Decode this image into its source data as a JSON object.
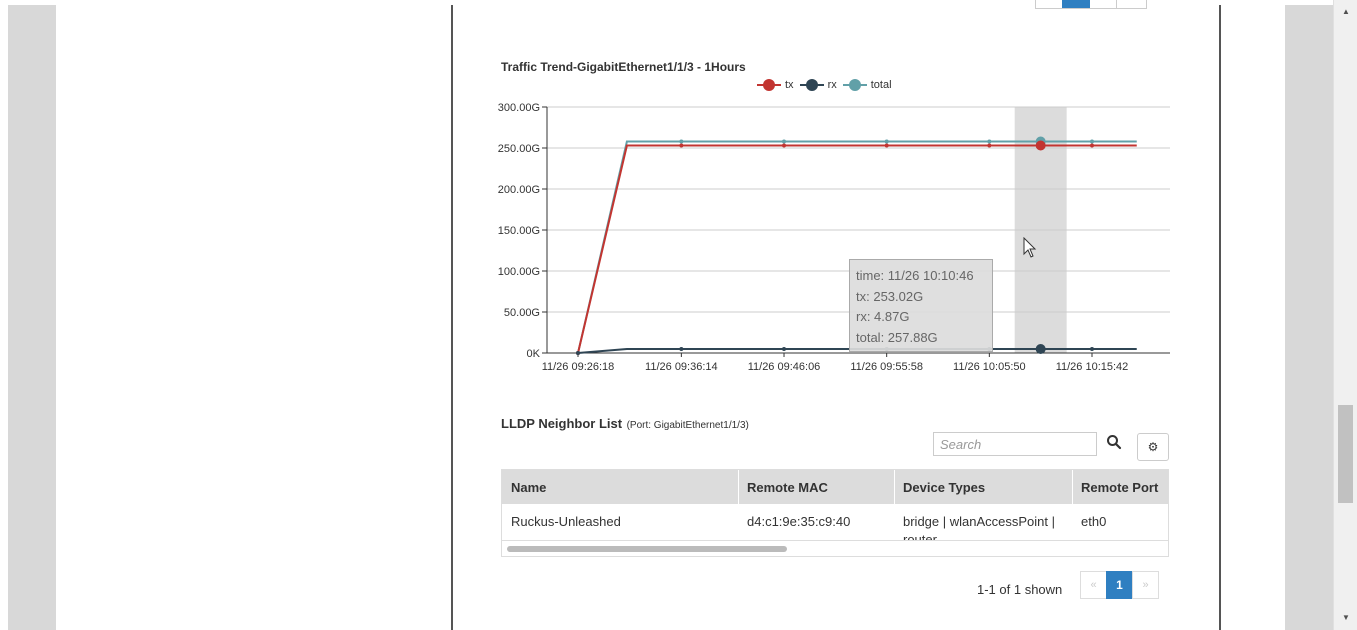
{
  "chart_data": {
    "type": "line",
    "title": "Traffic Trend-GigabitEthernet1/1/3 - 1Hours",
    "x_tick_labels": [
      "11/26 09:26:18",
      "11/26 09:36:14",
      "11/26 09:46:06",
      "11/26 09:55:58",
      "11/26 10:05:50",
      "11/26 10:15:42"
    ],
    "y_tick_labels": [
      "0K",
      "50.00G",
      "100.00G",
      "150.00G",
      "200.00G",
      "250.00G",
      "300.00G"
    ],
    "ylim": [
      0,
      300
    ],
    "y_unit": "G",
    "grid": true,
    "legend_position": "top",
    "x_points": [
      "11/26 09:26:18",
      "11/26 09:31:00",
      "11/26 09:36:14",
      "11/26 09:46:06",
      "11/26 09:55:58",
      "11/26 10:05:50",
      "11/26 10:10:46",
      "11/26 10:15:42",
      "11/26 10:20:00"
    ],
    "series": [
      {
        "name": "tx",
        "color": "#c23531",
        "values": [
          0,
          253,
          253,
          253,
          253,
          253,
          253.02,
          253,
          253
        ]
      },
      {
        "name": "rx",
        "color": "#2f4554",
        "values": [
          0,
          4.87,
          4.87,
          4.87,
          4.87,
          4.87,
          4.87,
          4.87,
          4.87
        ]
      },
      {
        "name": "total",
        "color": "#61a0a8",
        "values": [
          0,
          257.88,
          257.88,
          257.88,
          257.88,
          257.88,
          257.88,
          257.88,
          257.88
        ]
      }
    ],
    "highlight_x": "11/26 10:10:46"
  },
  "tooltip": {
    "time": "time: 11/26 10:10:46",
    "tx": "tx:  253.02G",
    "rx": "rx:  4.87G",
    "total": "total:  257.88G"
  },
  "lldp": {
    "title": "LLDP Neighbor List",
    "subtitle": "(Port: GigabitEthernet1/1/3)",
    "search_placeholder": "Search",
    "columns": [
      "Name",
      "Remote MAC",
      "Device Types",
      "Remote Port"
    ],
    "rows": [
      {
        "name": "Ruckus-Unleashed",
        "mac": "d4:c1:9e:35:c9:40",
        "device_types": "bridge | wlanAccessPoint |",
        "device_types_cont": "router",
        "port": "eth0"
      }
    ]
  },
  "pagination": {
    "info": "1-1 of 1 shown",
    "prev": "«",
    "current": "1",
    "next": "»"
  },
  "icons": {
    "search": "search-icon",
    "settings": "gear-icon",
    "cursor": "mouse-cursor-icon"
  }
}
